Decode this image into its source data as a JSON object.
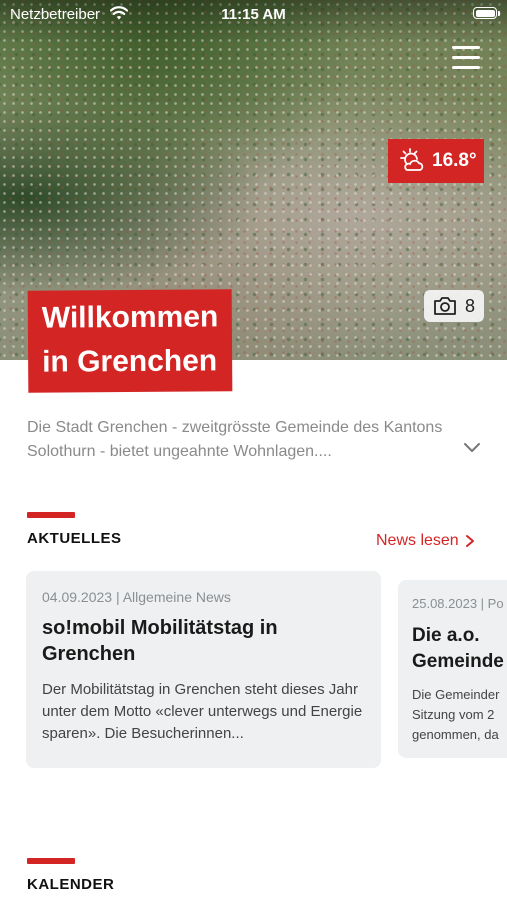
{
  "status_bar": {
    "carrier": "Netzbetreiber",
    "time": "11:15 AM"
  },
  "hero": {
    "title_line1": "Willkommen",
    "title_line2": "in Grenchen",
    "weather": {
      "temperature": "16.8°",
      "icon": "sun-cloud-icon"
    },
    "photo_count": "8"
  },
  "intro": {
    "text": "Die Stadt Grenchen - zweitgrösste Gemeinde des Kantons Solothurn - bietet ungeahnte Wohnlagen...."
  },
  "news": {
    "section_title": "AKTUELLES",
    "read_link": "News lesen",
    "cards": [
      {
        "meta": "04.09.2023 | Allgemeine News",
        "headline": "so!mobil Mobilitätstag in Grenchen",
        "teaser": "Der Mobilitätstag in Grenchen steht dieses Jahr unter dem Motto «clever unterwegs und Energie sparen». Die Besucherinnen..."
      },
      {
        "meta": "25.08.2023 | Po",
        "headline": "Die a.o. Gemeinde",
        "teaser": "Die Gemeinder Sitzung vom 2 genommen, da"
      }
    ]
  },
  "calendar": {
    "section_title": "KALENDER"
  },
  "colors": {
    "accent": "#d42525",
    "card_bg": "#eef0f1",
    "muted_text": "#8a8a8a"
  }
}
